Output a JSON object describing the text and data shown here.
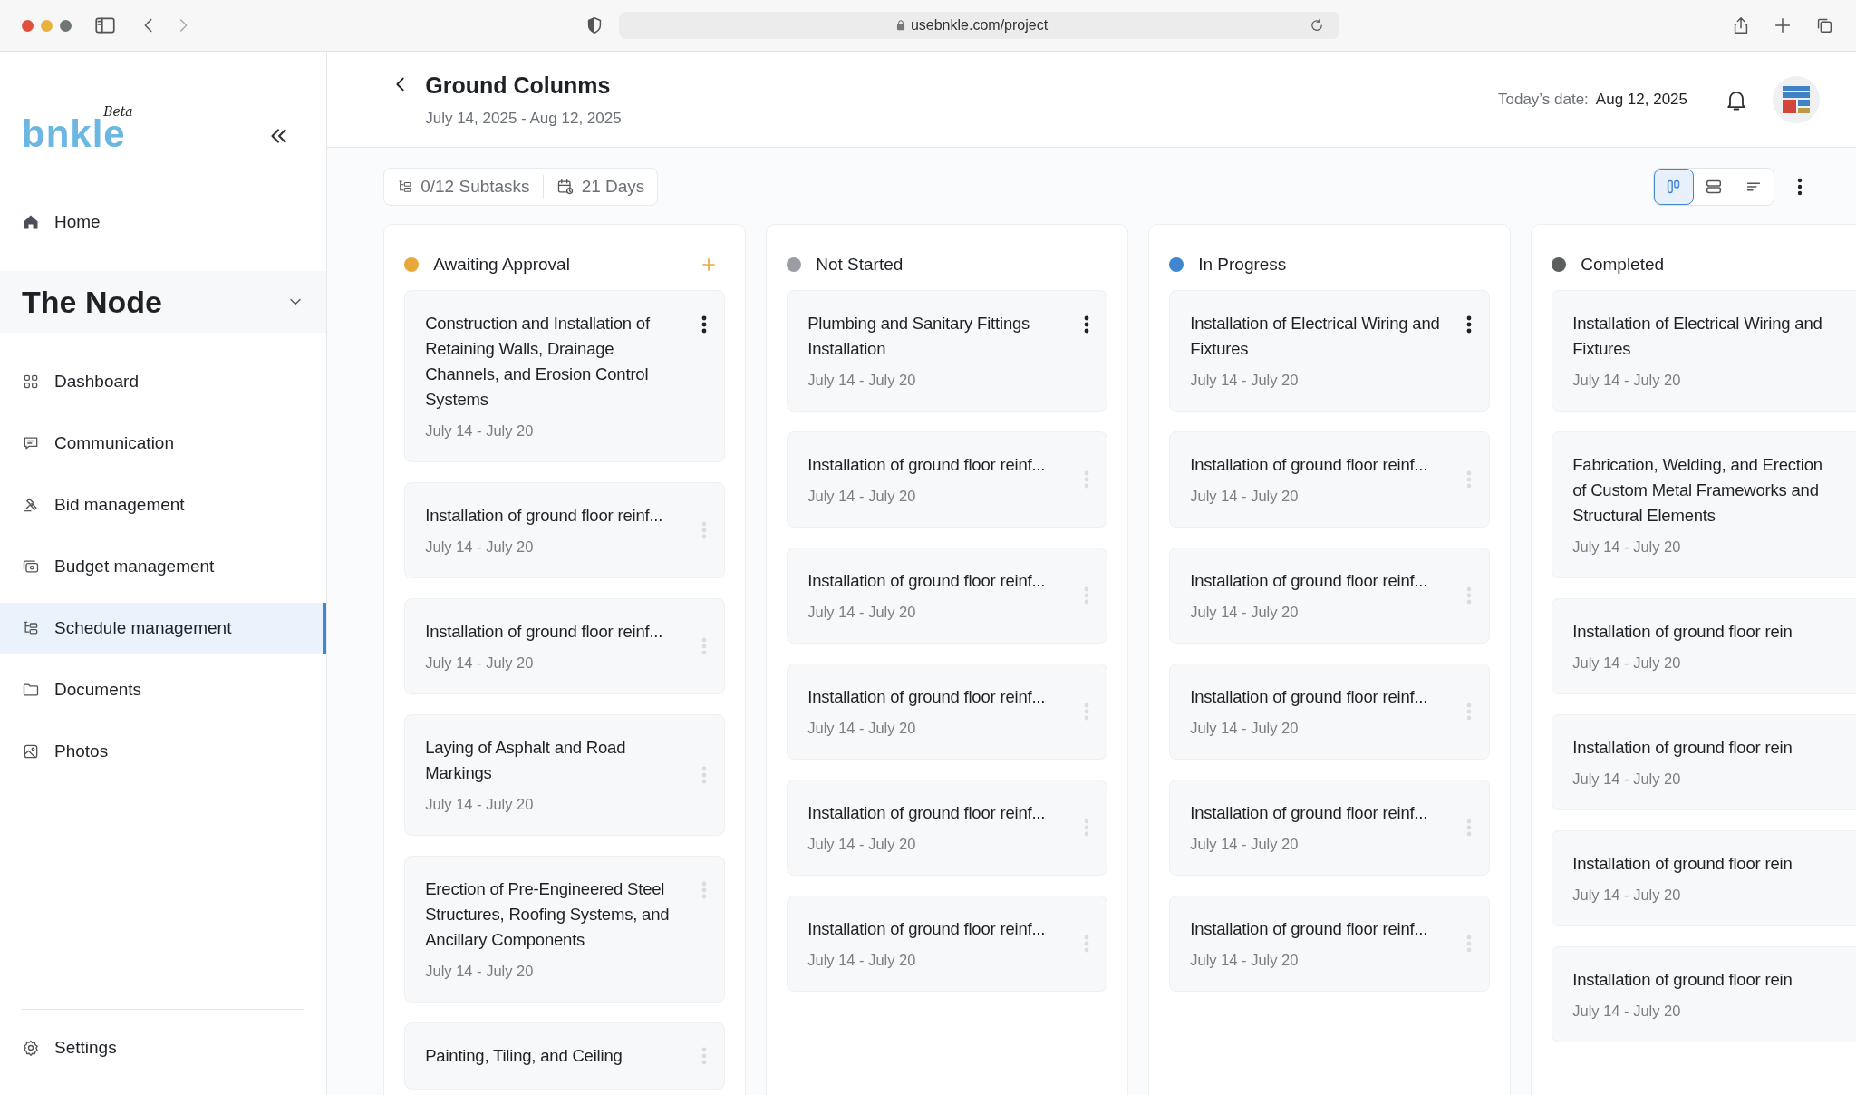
{
  "browser": {
    "url": "usebnkle.com/project"
  },
  "sidebar": {
    "logo": "bnkle",
    "logo_badge": "Beta",
    "home": "Home",
    "project": {
      "name": "The Node",
      "expanded": true
    },
    "items": [
      {
        "label": "Dashboard",
        "kind": "dashboard",
        "selected": false
      },
      {
        "label": "Communication",
        "kind": "chat",
        "selected": false
      },
      {
        "label": "Bid management",
        "kind": "gavel",
        "selected": false
      },
      {
        "label": "Budget management",
        "kind": "money",
        "selected": false
      },
      {
        "label": "Schedule management",
        "kind": "schedule",
        "selected": true
      },
      {
        "label": "Documents",
        "kind": "folder",
        "selected": false
      },
      {
        "label": "Photos",
        "kind": "image",
        "selected": false
      }
    ],
    "settings": "Settings"
  },
  "header": {
    "title": "Ground Colunms",
    "dates": "July 14, 2025 - Aug 12, 2025",
    "today_label": "Today’s date:",
    "today_value": "Aug 12, 2025"
  },
  "toolbar": {
    "subtasks": "0/12 Subtasks",
    "days": "21 Days",
    "views": [
      {
        "kind": "board",
        "selected": true
      },
      {
        "kind": "list",
        "selected": false
      },
      {
        "kind": "sort",
        "selected": false
      }
    ]
  },
  "columns": [
    {
      "title": "Awaiting Approval",
      "color": "#e8a93a",
      "can_add": true,
      "cards": [
        {
          "title": "Construction and Installation of Retaining Walls, Drainage Channels, and Erosion Control Systems",
          "dates": "July 14 - July 20",
          "menu_highlighted": true
        },
        {
          "title": "Installation of ground floor reinf...",
          "dates": "July 14 - July 20",
          "menu_highlighted": false
        },
        {
          "title": "Installation of ground floor reinf...",
          "dates": "July 14 - July 20",
          "menu_highlighted": false
        },
        {
          "title": "Laying of Asphalt and Road Markings",
          "dates": "July 14 - July 20",
          "menu_highlighted": false
        },
        {
          "title": "Erection of Pre-Engineered Steel Structures, Roofing Systems, and Ancillary Components",
          "dates": "July 14 - July 20",
          "menu_highlighted": false
        },
        {
          "title": "Painting, Tiling, and Ceiling",
          "menu_highlighted": false
        }
      ]
    },
    {
      "title": "Not Started",
      "color": "#9a9da1",
      "can_add": false,
      "cards": [
        {
          "title": "Plumbing and Sanitary Fittings Installation",
          "dates": "July 14 - July 20",
          "menu_highlighted": true
        },
        {
          "title": "Installation of ground floor reinf...",
          "dates": "July 14 - July 20",
          "menu_highlighted": false
        },
        {
          "title": "Installation of ground floor reinf...",
          "dates": "July 14 - July 20",
          "menu_highlighted": false
        },
        {
          "title": "Installation of ground floor reinf...",
          "dates": "July 14 - July 20",
          "menu_highlighted": false
        },
        {
          "title": "Installation of ground floor reinf...",
          "dates": "July 14 - July 20",
          "menu_highlighted": false
        },
        {
          "title": "Installation of ground floor reinf...",
          "dates": "July 14 - July 20",
          "menu_highlighted": false
        }
      ]
    },
    {
      "title": "In Progress",
      "color": "#3f87d0",
      "can_add": false,
      "cards": [
        {
          "title": "Installation of Electrical Wiring and Fixtures",
          "dates": "July 14 - July 20",
          "menu_highlighted": true
        },
        {
          "title": "Installation of ground floor reinf...",
          "dates": "July 14 - July 20",
          "menu_highlighted": false
        },
        {
          "title": "Installation of ground floor reinf...",
          "dates": "July 14 - July 20",
          "menu_highlighted": false
        },
        {
          "title": "Installation of ground floor reinf...",
          "dates": "July 14 - July 20",
          "menu_highlighted": false
        },
        {
          "title": "Installation of ground floor reinf...",
          "dates": "July 14 - July 20",
          "menu_highlighted": false
        },
        {
          "title": "Installation of ground floor reinf...",
          "dates": "July 14 - July 20",
          "menu_highlighted": false
        }
      ]
    },
    {
      "title": "Completed",
      "color": "#5b5f5e",
      "can_add": false,
      "cards": [
        {
          "title": "Installation of Electrical Wiring and Fixtures",
          "dates": "July 14 - July 20"
        },
        {
          "title": "Fabrication, Welding, and Erection of Custom Metal Frameworks and Structural Elements",
          "dates": "July 14 - July 20"
        },
        {
          "title": "Installation of ground floor rein",
          "dates": "July 14 - July 20"
        },
        {
          "title": "Installation of ground floor rein",
          "dates": "July 14 - July 20"
        },
        {
          "title": "Installation of ground floor rein",
          "dates": "July 14 - July 20"
        },
        {
          "title": "Installation of ground floor rein",
          "dates": "July 14 - July 20"
        }
      ]
    }
  ]
}
